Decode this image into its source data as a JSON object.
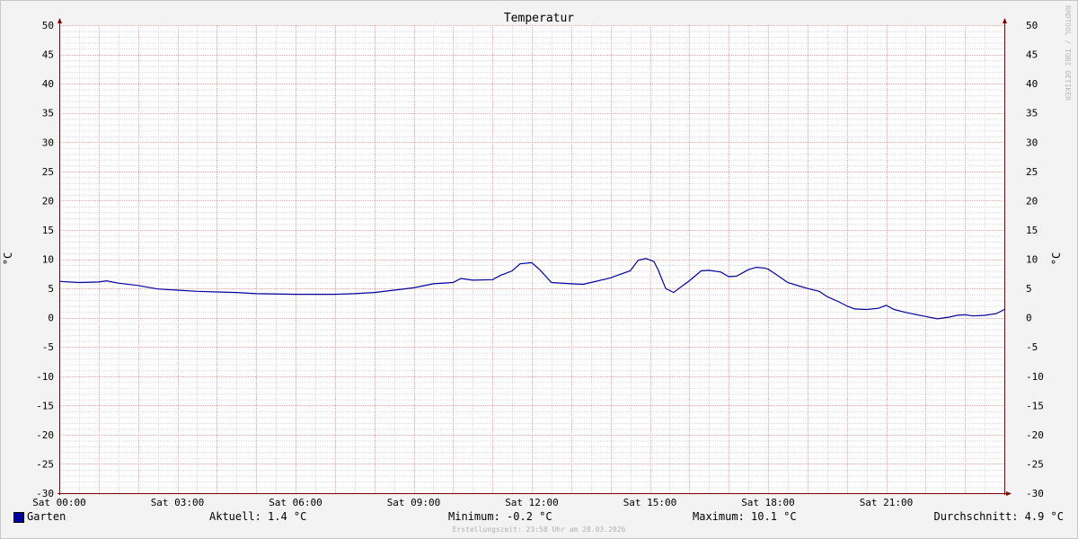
{
  "chart_data": {
    "type": "line",
    "title": "Temperatur",
    "ylabel": "°C",
    "ylabel_right": "°C",
    "xlabel": "",
    "ylim": [
      -30,
      50
    ],
    "y_ticks": [
      -30,
      -25,
      -20,
      -15,
      -10,
      -5,
      0,
      5,
      10,
      15,
      20,
      25,
      30,
      35,
      40,
      45,
      50
    ],
    "xlim": [
      0,
      24
    ],
    "x_tick_hours": [
      0,
      3,
      6,
      9,
      12,
      15,
      18,
      21
    ],
    "x_tick_labels": [
      "Sat 00:00",
      "Sat 03:00",
      "Sat 06:00",
      "Sat 09:00",
      "Sat 12:00",
      "Sat 15:00",
      "Sat 18:00",
      "Sat 21:00"
    ],
    "grid": true,
    "series": [
      {
        "name": "Garten",
        "color": "#0000a0",
        "x_hours": [
          0,
          0.5,
          1,
          1.2,
          1.5,
          2,
          2.5,
          3,
          3.5,
          4,
          4.5,
          5,
          6,
          7,
          7.5,
          8,
          8.5,
          9,
          9.5,
          10,
          10.2,
          10.5,
          11,
          11.2,
          11.5,
          11.7,
          12,
          12.2,
          12.5,
          13,
          13.3,
          13.5,
          14,
          14.2,
          14.5,
          14.7,
          14.9,
          15.1,
          15.2,
          15.4,
          15.6,
          16,
          16.3,
          16.5,
          16.8,
          17,
          17.2,
          17.5,
          17.7,
          17.9,
          18,
          18.2,
          18.5,
          18.8,
          19,
          19.3,
          19.5,
          19.8,
          20,
          20.2,
          20.5,
          20.8,
          21,
          21.2,
          21.5,
          22,
          22.3,
          22.6,
          22.8,
          23,
          23.2,
          23.5,
          23.8,
          24
        ],
        "values": [
          6.2,
          6.0,
          6.1,
          6.3,
          5.9,
          5.5,
          4.9,
          4.7,
          4.5,
          4.4,
          4.3,
          4.1,
          4.0,
          4.0,
          4.1,
          4.3,
          4.7,
          5.1,
          5.8,
          6.0,
          6.7,
          6.4,
          6.5,
          7.2,
          8.0,
          9.2,
          9.4,
          8.2,
          6.0,
          5.8,
          5.7,
          6.0,
          6.8,
          7.3,
          8.0,
          9.8,
          10.1,
          9.6,
          8.3,
          5.0,
          4.3,
          6.3,
          8.0,
          8.1,
          7.8,
          7.0,
          7.1,
          8.2,
          8.6,
          8.5,
          8.3,
          7.4,
          6.0,
          5.4,
          5.0,
          4.5,
          3.6,
          2.7,
          2.0,
          1.5,
          1.4,
          1.6,
          2.1,
          1.4,
          0.9,
          0.2,
          -0.2,
          0.1,
          0.4,
          0.5,
          0.3,
          0.4,
          0.7,
          1.4
        ]
      }
    ]
  },
  "legend": {
    "series_name": "Garten",
    "current": "Aktuell: 1.4 °C",
    "minimum": "Minimum: -0.2 °C",
    "maximum": "Maximum: 10.1 °C",
    "average": "Durchschnitt: 4.9 °C"
  },
  "footnote": "Erstellungszeit: 23:58 Uhr am 28.03.2026",
  "watermark": "RRDTOOL / TOBI OETIKER",
  "colors": {
    "background": "#f3f3f3",
    "plot_bg": "#ffffff",
    "major_grid": "#f0a0a0",
    "minor_grid": "#d8d8d8",
    "axis": "#800000",
    "series": "#0000a0"
  }
}
